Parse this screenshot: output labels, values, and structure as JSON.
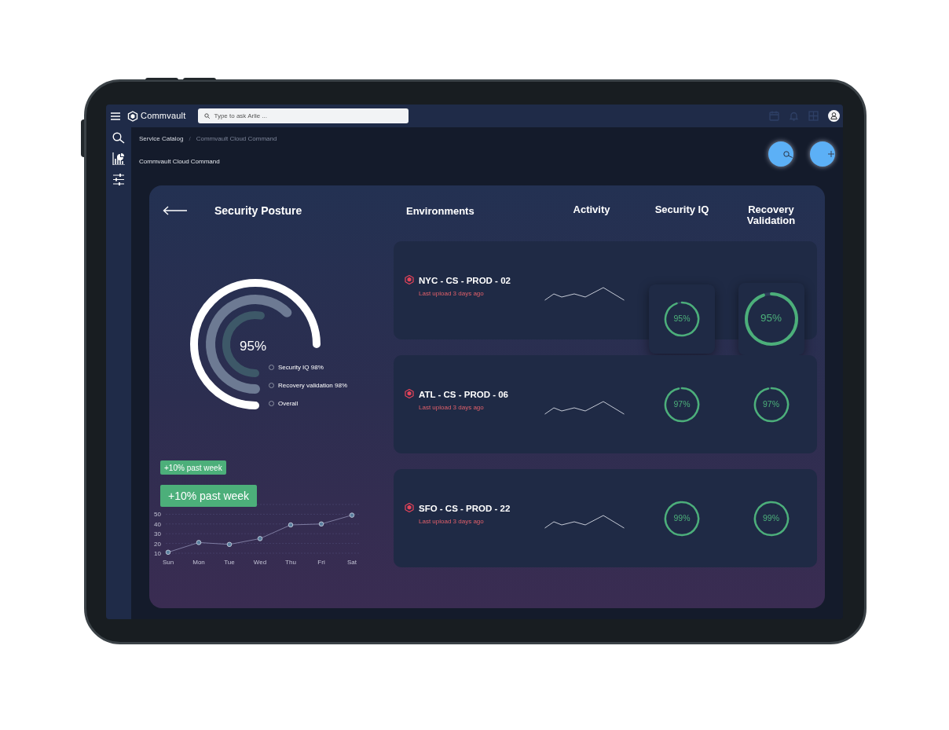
{
  "topbar": {
    "logo": "Commvault",
    "search": {
      "placeholder": "Type to ask Arlie ..."
    }
  },
  "breadcrumb": {
    "separator": "/",
    "items": [
      {
        "label": "Service Catalog",
        "current": false
      },
      {
        "label": "Commvault Cloud Command",
        "current": true
      }
    ]
  },
  "page_title": "Commvault Cloud Command",
  "posture": {
    "title": "Security Posture",
    "value": "95%",
    "series": [
      {
        "label": "Security IQ 98%",
        "color": "#3d5868"
      },
      {
        "label": "Recovery validation 98%",
        "color": "#6d7a93"
      },
      {
        "label": "Overall",
        "color": "#ffffff"
      }
    ],
    "badges": [
      "+10% past week",
      "+10% past week"
    ],
    "chart_data": {
      "type": "line",
      "categories": [
        "Sun",
        "Mon",
        "Tue",
        "Wed",
        "Thu",
        "Fri",
        "Sat"
      ],
      "values": [
        11,
        21,
        19,
        25,
        39,
        40,
        49
      ],
      "yticks": [
        10,
        20,
        30,
        40,
        50
      ],
      "ylim": [
        10,
        60
      ],
      "grid": true,
      "marker": "circle"
    }
  },
  "columns": [
    "Environments",
    "Activity",
    "Security IQ",
    "Recovery Validation"
  ],
  "environments": [
    {
      "name": "NYC - CS - PROD - 02",
      "subtitle": "Last upload 3 days ago",
      "raised": true,
      "security_iq": {
        "value": "95%",
        "level": 0.95
      },
      "recovery": {
        "value": "95%",
        "level": 0.95
      }
    },
    {
      "name": "ATL - CS - PROD - 06",
      "subtitle": "Last upload 3 days ago",
      "raised": false,
      "security_iq": {
        "value": "97%",
        "level": 0.97
      },
      "recovery": {
        "value": "97%",
        "level": 0.97
      }
    },
    {
      "name": "SFO - CS - PROD - 22",
      "subtitle": "Last upload 3 days ago",
      "raised": false,
      "security_iq": {
        "value": "99%",
        "level": 0.99
      },
      "recovery": {
        "value": "99%",
        "level": 0.99
      }
    }
  ]
}
